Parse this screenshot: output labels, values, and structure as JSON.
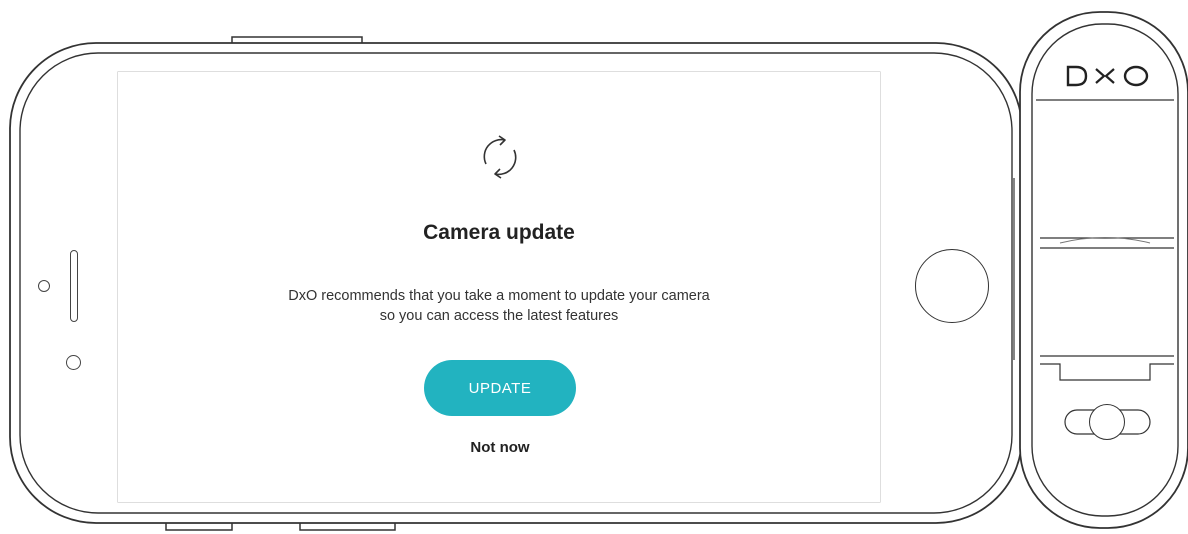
{
  "dialog": {
    "icon": "sync-icon",
    "title": "Camera update",
    "message_line1": "DxO recommends that you take a moment to update your camera",
    "message_line2": "so you can access the latest features",
    "update_button": "UPDATE",
    "dismiss_link": "Not now"
  },
  "device": {
    "brand_logo_text": "DXO"
  },
  "colors": {
    "accent": "#22b3c0",
    "outline": "#333333",
    "background": "#ffffff"
  }
}
